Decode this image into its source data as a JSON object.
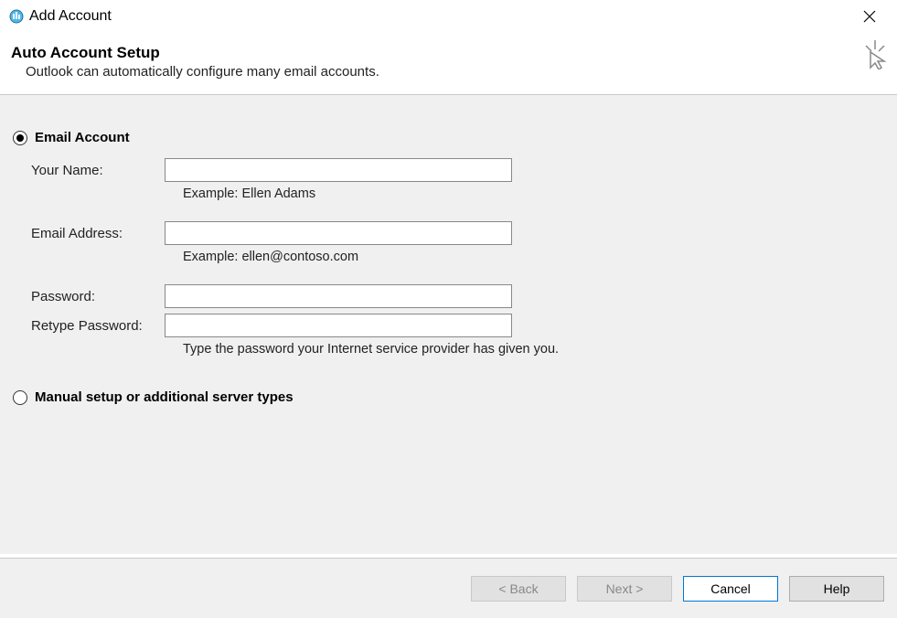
{
  "window": {
    "title": "Add Account"
  },
  "header": {
    "title": "Auto Account Setup",
    "subtitle": "Outlook can automatically configure many email accounts."
  },
  "radio": {
    "email_account_label": "Email Account",
    "manual_label": "Manual setup or additional server types",
    "selected": "email_account"
  },
  "form": {
    "your_name_label": "Your Name:",
    "your_name_value": "",
    "your_name_hint": "Example: Ellen Adams",
    "email_label": "Email Address:",
    "email_value": "",
    "email_hint": "Example: ellen@contoso.com",
    "password_label": "Password:",
    "password_value": "",
    "retype_label": "Retype Password:",
    "retype_value": "",
    "password_hint": "Type the password your Internet service provider has given you."
  },
  "buttons": {
    "back": "< Back",
    "next": "Next >",
    "cancel": "Cancel",
    "help": "Help"
  }
}
